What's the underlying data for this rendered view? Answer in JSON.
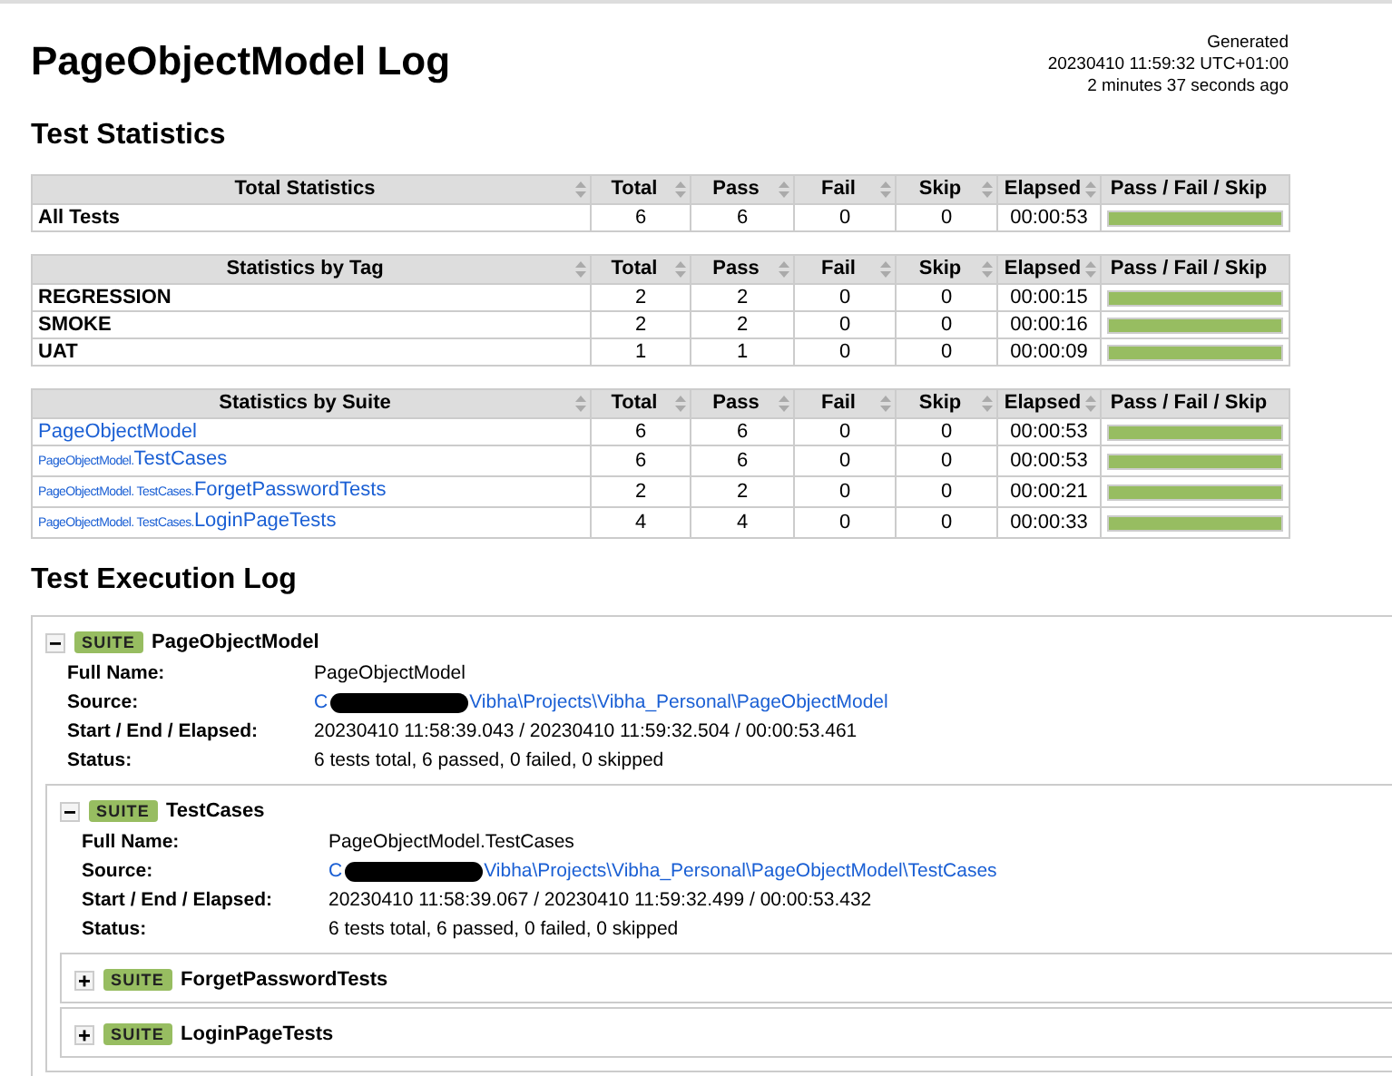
{
  "title": "PageObjectModel Log",
  "generated": {
    "label": "Generated",
    "timestamp": "20230410 11:59:32 UTC+01:00",
    "ago": "2 minutes 37 seconds ago"
  },
  "statistics_heading": "Test Statistics",
  "stat_tables": [
    {
      "kind": "plain",
      "columns": [
        "Total Statistics",
        "Total",
        "Pass",
        "Fail",
        "Skip",
        "Elapsed",
        "Pass / Fail / Skip"
      ],
      "rows": [
        {
          "name": "All Tests",
          "total": "6",
          "pass": "6",
          "fail": "0",
          "skip": "0",
          "elapsed": "00:00:53",
          "level": 1
        }
      ]
    },
    {
      "kind": "plain",
      "columns": [
        "Statistics by Tag",
        "Total",
        "Pass",
        "Fail",
        "Skip",
        "Elapsed",
        "Pass / Fail / Skip"
      ],
      "rows": [
        {
          "name": "REGRESSION",
          "total": "2",
          "pass": "2",
          "fail": "0",
          "skip": "0",
          "elapsed": "00:00:15",
          "level": 1
        },
        {
          "name": "SMOKE",
          "total": "2",
          "pass": "2",
          "fail": "0",
          "skip": "0",
          "elapsed": "00:00:16",
          "level": 1
        },
        {
          "name": "UAT",
          "total": "1",
          "pass": "1",
          "fail": "0",
          "skip": "0",
          "elapsed": "00:00:09",
          "level": 1
        }
      ]
    },
    {
      "kind": "link",
      "columns": [
        "Statistics by Suite",
        "Total",
        "Pass",
        "Fail",
        "Skip",
        "Elapsed",
        "Pass / Fail / Skip"
      ],
      "rows": [
        {
          "parent": "",
          "name": "PageObjectModel",
          "total": "6",
          "pass": "6",
          "fail": "0",
          "skip": "0",
          "elapsed": "00:00:53",
          "level": 1
        },
        {
          "parent": "PageObjectModel.",
          "name": "TestCases",
          "total": "6",
          "pass": "6",
          "fail": "0",
          "skip": "0",
          "elapsed": "00:00:53",
          "level": 1
        },
        {
          "parent": "PageObjectModel. TestCases.",
          "name": "ForgetPasswordTests",
          "total": "2",
          "pass": "2",
          "fail": "0",
          "skip": "0",
          "elapsed": "00:00:21",
          "level": 1
        },
        {
          "parent": "PageObjectModel. TestCases.",
          "name": "LoginPageTests",
          "total": "4",
          "pass": "4",
          "fail": "0",
          "skip": "0",
          "elapsed": "00:00:33",
          "level": 1
        }
      ]
    }
  ],
  "execution_heading": "Test Execution Log",
  "suites": [
    {
      "badge": "SUITE",
      "name": "PageObjectModel",
      "expanded": true,
      "details": [
        {
          "kind": "text",
          "label": "Full Name:",
          "value": "PageObjectModel"
        },
        {
          "kind": "source",
          "label": "Source:",
          "prefix": "C",
          "value": "Vibha\\Projects\\Vibha_Personal\\PageObjectModel"
        },
        {
          "kind": "text",
          "label": "Start / End / Elapsed:",
          "value": "20230410 11:58:39.043 / 20230410 11:59:32.504 / 00:00:53.461"
        },
        {
          "kind": "text",
          "label": "Status:",
          "value": "6 tests total, 6 passed, 0 failed, 0 skipped"
        }
      ],
      "children": [
        {
          "badge": "SUITE",
          "name": "TestCases",
          "expanded": true,
          "details": [
            {
              "kind": "text",
              "label": "Full Name:",
              "value": "PageObjectModel.TestCases"
            },
            {
              "kind": "source",
              "label": "Source:",
              "prefix": "C",
              "value": "Vibha\\Projects\\Vibha_Personal\\PageObjectModel\\TestCases"
            },
            {
              "kind": "text",
              "label": "Start / End / Elapsed:",
              "value": "20230410 11:58:39.067 / 20230410 11:59:32.499 / 00:00:53.432"
            },
            {
              "kind": "text",
              "label": "Status:",
              "value": "6 tests total, 6 passed, 0 failed, 0 skipped"
            }
          ],
          "children": [
            {
              "badge": "SUITE",
              "name": "ForgetPasswordTests",
              "expanded": false
            },
            {
              "badge": "SUITE",
              "name": "LoginPageTests",
              "expanded": false
            }
          ]
        }
      ]
    }
  ]
}
